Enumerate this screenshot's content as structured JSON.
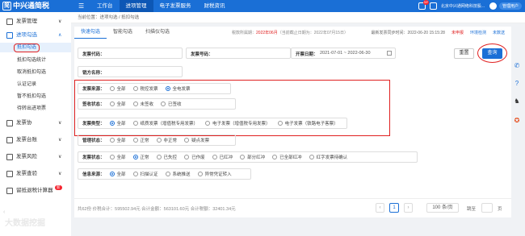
{
  "header": {
    "brand": "中兴通简税",
    "logo": "简",
    "menu_toggle": "☰",
    "nav": [
      "工作台",
      "进项管理",
      "电子发票服务",
      "财税资讯"
    ],
    "notify_count": "12",
    "company": "北京中兴通网络科技股...",
    "user_role": "管理用户"
  },
  "sidebar": {
    "items": [
      {
        "label": "发票管理",
        "caret": "∨"
      },
      {
        "label": "进项勾选",
        "caret": "∧"
      }
    ],
    "subitems": [
      "抵扣勾选",
      "抵扣勾选统计",
      "取消抵扣勾选",
      "认证记录",
      "暂不抵扣勾选",
      "待转出进项票"
    ],
    "items2": [
      {
        "label": "发票协",
        "caret": "∨"
      },
      {
        "label": "发票台账",
        "caret": "∨"
      },
      {
        "label": "发票风险",
        "caret": "∨"
      },
      {
        "label": "发票查验",
        "caret": "∨"
      },
      {
        "label": "留抵退税计算器",
        "badge": "新"
      }
    ],
    "collapse": "‹"
  },
  "breadcrumb": "当前位置：进项勾选 / 抵扣勾选",
  "tabs": [
    "快速勾选",
    "智能勾选",
    "扫描仪勾选"
  ],
  "deadline": {
    "label": "税款所属期：",
    "period": "2022年06月",
    "note": "（当前截止日期为：2022年07月15日）"
  },
  "rightinfo": {
    "sync": "最新发票同步时间：2022-06-20 15:15:28",
    "unreported": "未申报",
    "env": "环境检测",
    "not_sent": "未数送"
  },
  "filters": {
    "invoice_code_label": "发票代码：",
    "invoice_no_label": "发票号码：",
    "issue_date_label": "开票日期：",
    "issue_date_value": "2021-07-01 ~ 2022-06-30",
    "seller_label": "销方名称：",
    "reset": "重置",
    "query": "查询"
  },
  "groups": [
    {
      "label": "发票来源：",
      "options": [
        "全部",
        "税控发票",
        "全电发票"
      ],
      "selected": 2
    },
    {
      "label": "签收状态：",
      "options": [
        "全部",
        "未签收",
        "已签收"
      ],
      "selected": -1
    },
    {
      "label": "发票类型：",
      "options": [
        "全部",
        "纸质发票（增值税专用发票）",
        "电子发票（增值税专用发票）",
        "电子发票（铁路电子客票）"
      ],
      "selected": 0
    },
    {
      "label": "管理状态：",
      "options": [
        "全部",
        "正常",
        "非正常",
        "疑点发票"
      ],
      "selected": -1
    },
    {
      "label": "发票状态：",
      "options": [
        "全部",
        "正常",
        "已失控",
        "已作废",
        "已红冲",
        "部分红冲",
        "已全部红冲",
        "红字发票待确认"
      ],
      "selected": 1
    },
    {
      "label": "信息来源：",
      "options": [
        "全部",
        "扫描认证",
        "系统推送",
        "异常凭证转入"
      ],
      "selected": 0
    }
  ],
  "footer": {
    "summary": "共62份 价税合计：595502.94元 合计金额：563101.60元 合计税额：32401.34元",
    "current_page": "1",
    "page_size": "100 条/页",
    "goto": "跳至",
    "page_unit": "页"
  },
  "watermark": "大数据挖掘"
}
